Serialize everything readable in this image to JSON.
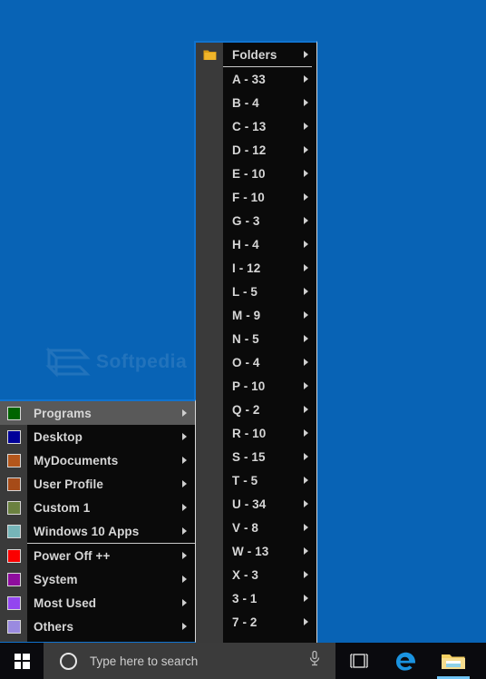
{
  "desktop": {
    "background_color": "#0863b5",
    "watermark_text": "Softpedia"
  },
  "main_menu": {
    "name": "classic-start-menu",
    "items": [
      {
        "label": "Programs",
        "swatch": "#006400",
        "highlighted": true,
        "has_submenu": true
      },
      {
        "label": "Desktop",
        "swatch": "#000099",
        "highlighted": false,
        "has_submenu": true
      },
      {
        "label": "MyDocuments",
        "swatch": "#b4561b",
        "highlighted": false,
        "has_submenu": true
      },
      {
        "label": "User Profile",
        "swatch": "#a64b18",
        "highlighted": false,
        "has_submenu": true
      },
      {
        "label": "Custom 1",
        "swatch": "#6b8140",
        "highlighted": false,
        "has_submenu": true
      },
      {
        "label": "Windows 10 Apps",
        "swatch": "#76b5b8",
        "highlighted": false,
        "has_submenu": true
      },
      {
        "label": "Power Off ++",
        "swatch": "#fb0000",
        "highlighted": false,
        "has_submenu": true,
        "separator_before": true
      },
      {
        "label": "System",
        "swatch": "#8e0c9e",
        "highlighted": false,
        "has_submenu": true
      },
      {
        "label": "Most Used",
        "swatch": "#9346ef",
        "highlighted": false,
        "has_submenu": true
      },
      {
        "label": "Others",
        "swatch": "#9a8ae0",
        "highlighted": false,
        "has_submenu": true
      }
    ]
  },
  "folders_submenu": {
    "header": {
      "label": "Folders",
      "icon": "folder-icon",
      "has_submenu": true
    },
    "items": [
      {
        "label": "A - 33",
        "has_submenu": true
      },
      {
        "label": "B - 4",
        "has_submenu": true
      },
      {
        "label": "C - 13",
        "has_submenu": true
      },
      {
        "label": "D - 12",
        "has_submenu": true
      },
      {
        "label": "E - 10",
        "has_submenu": true
      },
      {
        "label": "F - 10",
        "has_submenu": true
      },
      {
        "label": "G - 3",
        "has_submenu": true
      },
      {
        "label": "H - 4",
        "has_submenu": true
      },
      {
        "label": "I - 12",
        "has_submenu": true
      },
      {
        "label": "L - 5",
        "has_submenu": true
      },
      {
        "label": "M - 9",
        "has_submenu": true
      },
      {
        "label": "N - 5",
        "has_submenu": true
      },
      {
        "label": "O - 4",
        "has_submenu": true
      },
      {
        "label": "P - 10",
        "has_submenu": true
      },
      {
        "label": "Q - 2",
        "has_submenu": true
      },
      {
        "label": "R - 10",
        "has_submenu": true
      },
      {
        "label": "S - 15",
        "has_submenu": true
      },
      {
        "label": "T - 5",
        "has_submenu": true
      },
      {
        "label": "U - 34",
        "has_submenu": true
      },
      {
        "label": "V - 8",
        "has_submenu": true
      },
      {
        "label": "W - 13",
        "has_submenu": true
      },
      {
        "label": "X - 3",
        "has_submenu": true
      },
      {
        "label": "3 - 1",
        "has_submenu": true
      },
      {
        "label": "7 - 2",
        "has_submenu": true
      }
    ]
  },
  "taskbar": {
    "start_button": "start-button",
    "search": {
      "placeholder": "Type here to search",
      "value": "",
      "cortana_icon": "cortana-circle-icon",
      "mic_icon": "microphone-icon"
    },
    "icons": [
      {
        "name": "task-view-icon",
        "active": false
      },
      {
        "name": "edge-browser-icon",
        "active": false
      },
      {
        "name": "file-explorer-icon",
        "active": true
      }
    ]
  }
}
